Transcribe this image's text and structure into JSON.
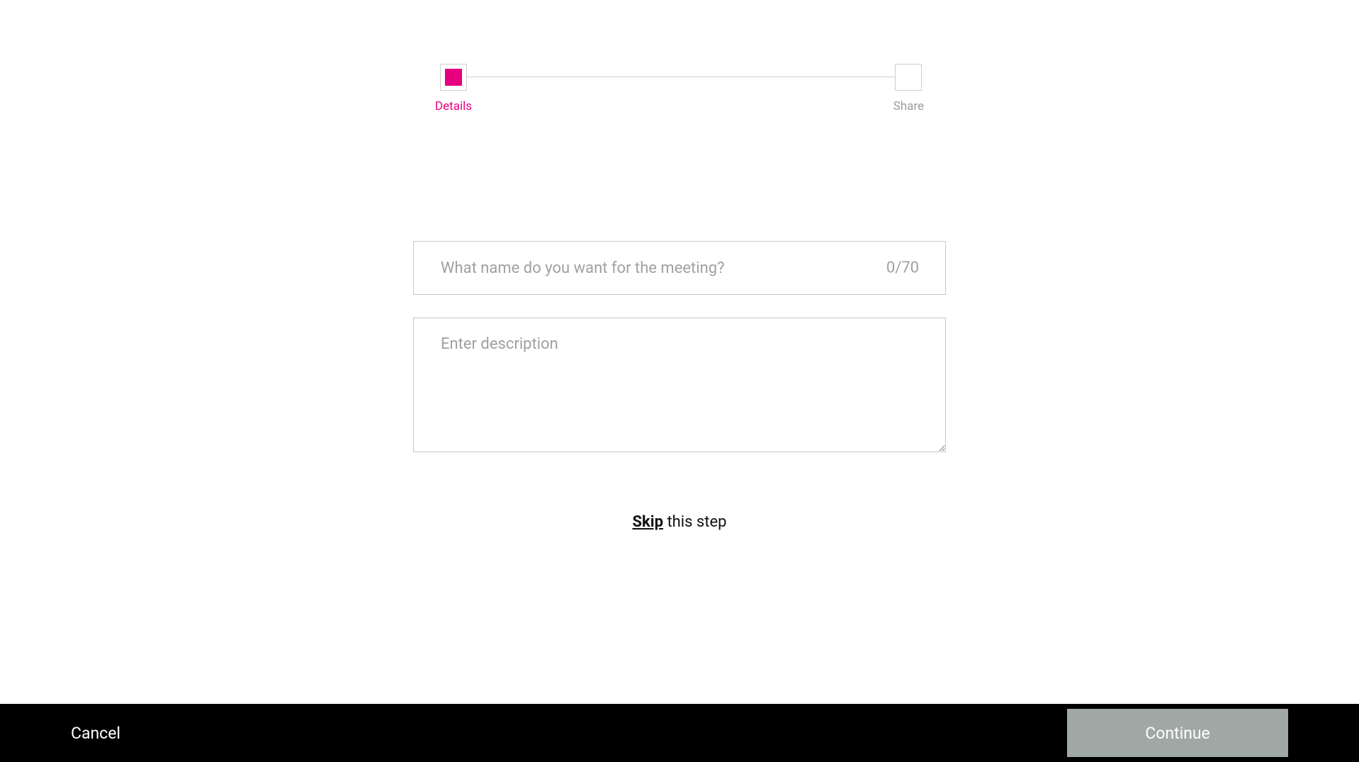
{
  "stepper": {
    "steps": [
      {
        "label": "Details",
        "active": true
      },
      {
        "label": "Share",
        "active": false
      }
    ]
  },
  "form": {
    "name_placeholder": "What name do you want for the meeting?",
    "name_value": "",
    "char_count": "0/70",
    "desc_placeholder": "Enter description",
    "desc_value": ""
  },
  "skip": {
    "skip_word": "Skip",
    "rest": " this step"
  },
  "footer": {
    "cancel_label": "Cancel",
    "continue_label": "Continue"
  },
  "colors": {
    "accent": "#e6007e",
    "footer_bg": "#000000",
    "continue_bg": "#a0a8a5"
  }
}
